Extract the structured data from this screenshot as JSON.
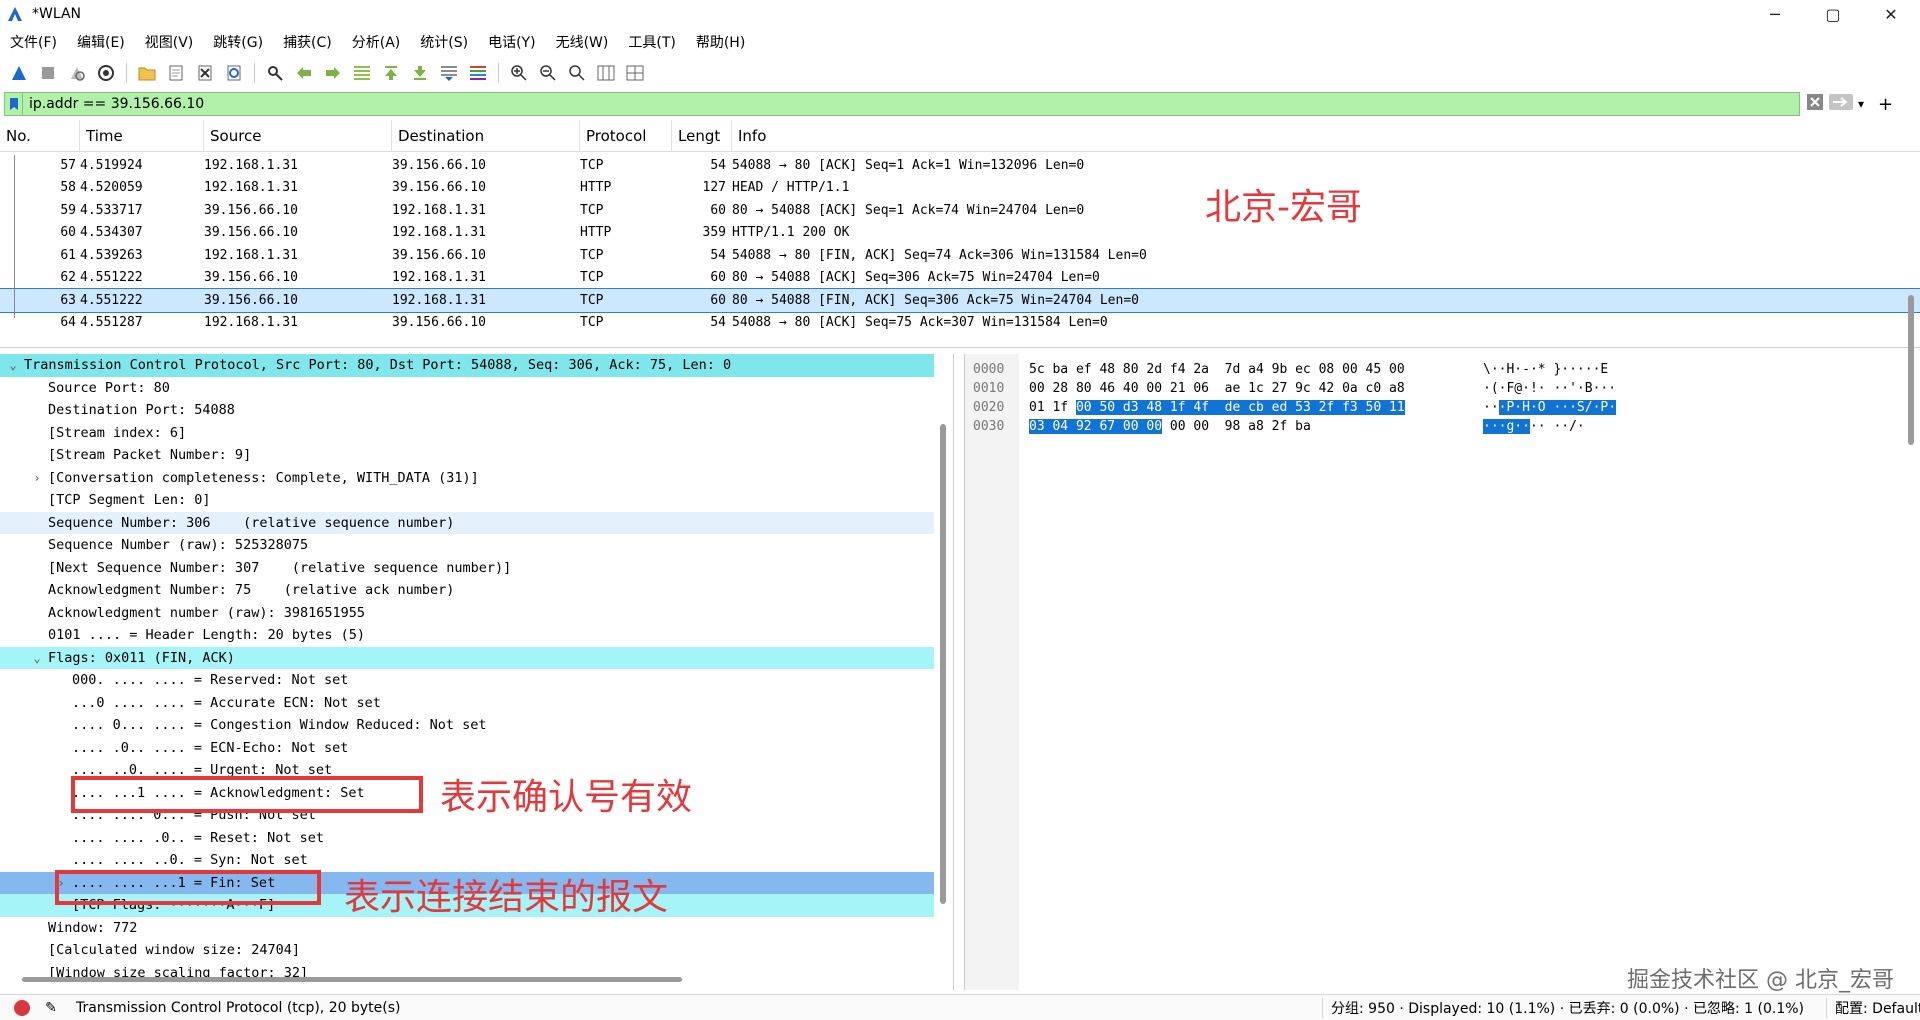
{
  "window": {
    "title": "*WLAN",
    "controls": [
      "─",
      "▢",
      "✕"
    ]
  },
  "menu": [
    "文件(F)",
    "编辑(E)",
    "视图(V)",
    "跳转(G)",
    "捕获(C)",
    "分析(A)",
    "统计(S)",
    "电话(Y)",
    "无线(W)",
    "工具(T)",
    "帮助(H)"
  ],
  "filter": {
    "value": "ip.addr == 39.156.66.10"
  },
  "packet_list": {
    "headers": [
      "No.",
      "Time",
      "Source",
      "Destination",
      "Protocol",
      "Lengt",
      "Info"
    ],
    "rows": [
      [
        "57",
        "4.519924",
        "192.168.1.31",
        "39.156.66.10",
        "TCP",
        "54",
        "54088 → 80 [ACK] Seq=1 Ack=1 Win=132096 Len=0"
      ],
      [
        "58",
        "4.520059",
        "192.168.1.31",
        "39.156.66.10",
        "HTTP",
        "127",
        "HEAD / HTTP/1.1"
      ],
      [
        "59",
        "4.533717",
        "39.156.66.10",
        "192.168.1.31",
        "TCP",
        "60",
        "80 → 54088 [ACK] Seq=1 Ack=74 Win=24704 Len=0"
      ],
      [
        "60",
        "4.534307",
        "39.156.66.10",
        "192.168.1.31",
        "HTTP",
        "359",
        "HTTP/1.1 200 OK"
      ],
      [
        "61",
        "4.539263",
        "192.168.1.31",
        "39.156.66.10",
        "TCP",
        "54",
        "54088 → 80 [FIN, ACK] Seq=74 Ack=306 Win=131584 Len=0"
      ],
      [
        "62",
        "4.551222",
        "39.156.66.10",
        "192.168.1.31",
        "TCP",
        "60",
        "80 → 54088 [ACK] Seq=306 Ack=75 Win=24704 Len=0"
      ],
      [
        "63",
        "4.551222",
        "39.156.66.10",
        "192.168.1.31",
        "TCP",
        "60",
        "80 → 54088 [FIN, ACK] Seq=306 Ack=75 Win=24704 Len=0"
      ],
      [
        "64",
        "4.551287",
        "192.168.1.31",
        "39.156.66.10",
        "TCP",
        "54",
        "54088 → 80 [ACK] Seq=75 Ack=307 Win=131584 Len=0"
      ]
    ],
    "selected_index": 6
  },
  "details": [
    {
      "indent": 0,
      "twist": "⌄",
      "text": "Transmission Control Protocol, Src Port: 80, Dst Port: 54088, Seq: 306, Ack: 75, Len: 0",
      "hl": "hl-top"
    },
    {
      "indent": 1,
      "twist": "",
      "text": "Source Port: 80",
      "hl": ""
    },
    {
      "indent": 1,
      "twist": "",
      "text": "Destination Port: 54088",
      "hl": ""
    },
    {
      "indent": 1,
      "twist": "",
      "text": "[Stream index: 6]",
      "hl": ""
    },
    {
      "indent": 1,
      "twist": "",
      "text": "[Stream Packet Number: 9]",
      "hl": ""
    },
    {
      "indent": 1,
      "twist": "›",
      "text": "[Conversation completeness: Complete, WITH_DATA (31)]",
      "hl": ""
    },
    {
      "indent": 1,
      "twist": "",
      "text": "[TCP Segment Len: 0]",
      "hl": ""
    },
    {
      "indent": 1,
      "twist": "",
      "text": "Sequence Number: 306    (relative sequence number)",
      "hl": "hl-light"
    },
    {
      "indent": 1,
      "twist": "",
      "text": "Sequence Number (raw): 525328075",
      "hl": ""
    },
    {
      "indent": 1,
      "twist": "",
      "text": "[Next Sequence Number: 307    (relative sequence number)]",
      "hl": ""
    },
    {
      "indent": 1,
      "twist": "",
      "text": "Acknowledgment Number: 75    (relative ack number)",
      "hl": ""
    },
    {
      "indent": 1,
      "twist": "",
      "text": "Acknowledgment number (raw): 3981651955",
      "hl": ""
    },
    {
      "indent": 1,
      "twist": "",
      "text": "0101 .... = Header Length: 20 bytes (5)",
      "hl": ""
    },
    {
      "indent": 1,
      "twist": "⌄",
      "text": "Flags: 0x011 (FIN, ACK)",
      "hl": "hl-cyan"
    },
    {
      "indent": 2,
      "twist": "",
      "text": "000. .... .... = Reserved: Not set",
      "hl": ""
    },
    {
      "indent": 2,
      "twist": "",
      "text": "...0 .... .... = Accurate ECN: Not set",
      "hl": ""
    },
    {
      "indent": 2,
      "twist": "",
      "text": ".... 0... .... = Congestion Window Reduced: Not set",
      "hl": ""
    },
    {
      "indent": 2,
      "twist": "",
      "text": ".... .0.. .... = ECN-Echo: Not set",
      "hl": ""
    },
    {
      "indent": 2,
      "twist": "",
      "text": ".... ..0. .... = Urgent: Not set",
      "hl": ""
    },
    {
      "indent": 2,
      "twist": "",
      "text": ".... ...1 .... = Acknowledgment: Set",
      "hl": ""
    },
    {
      "indent": 2,
      "twist": "",
      "text": ".... .... 0... = Push: Not set",
      "hl": ""
    },
    {
      "indent": 2,
      "twist": "",
      "text": ".... .... .0.. = Reset: Not set",
      "hl": ""
    },
    {
      "indent": 2,
      "twist": "",
      "text": ".... .... ..0. = Syn: Not set",
      "hl": ""
    },
    {
      "indent": 2,
      "twist": "›",
      "text": ".... .... ...1 = Fin: Set",
      "hl": "hl-blue"
    },
    {
      "indent": 2,
      "twist": "",
      "text": "[TCP Flags: ·······A···F]",
      "hl": "hl-cyan"
    },
    {
      "indent": 1,
      "twist": "",
      "text": "Window: 772",
      "hl": ""
    },
    {
      "indent": 1,
      "twist": "",
      "text": "[Calculated window size: 24704]",
      "hl": ""
    },
    {
      "indent": 1,
      "twist": "",
      "text": "[Window size scaling factor: 32]",
      "hl": ""
    }
  ],
  "hex": [
    {
      "off": "0000",
      "bytes": [
        [
          "5c ba ef 48 80 2d f4 2a  7d a4 9b ec 08 00 45 00",
          false
        ]
      ],
      "ascii": [
        [
          "\\··H·-·* }·····E",
          false
        ]
      ]
    },
    {
      "off": "0010",
      "bytes": [
        [
          "00 28 80 46 40 00 21 06  ae 1c 27 9c 42 0a c0 a8",
          false
        ]
      ],
      "ascii": [
        [
          "·(·F@·!· ··'·B···",
          false
        ]
      ]
    },
    {
      "off": "0020",
      "bytes": [
        [
          "01 1f ",
          false
        ],
        [
          "00 50 d3 48 1f 4f  de cb ed 53 2f f3 50 11",
          true
        ]
      ],
      "ascii": [
        [
          "··",
          false
        ],
        [
          "·P·H·O ···S/·P·",
          true
        ]
      ]
    },
    {
      "off": "0030",
      "bytes": [
        [
          "03 04 92 67 00 00",
          true
        ],
        [
          " 00 00  98 a8 2f ba",
          false
        ]
      ],
      "ascii": [
        [
          "···g··",
          true
        ],
        [
          "·· ··/·",
          false
        ]
      ]
    }
  ],
  "annotations": {
    "title": "北京-宏哥",
    "ack_note": "表示确认号有效",
    "fin_note": "表示连接结束的报文"
  },
  "watermark": "掘金技术社区 @ 北京_宏哥",
  "status": {
    "left": "Transmission Control Protocol (tcp), 20 byte(s)",
    "packets": "分组: 950 · Displayed: 10 (1.1%) · 已丢弃: 0 (0.0%) · 已忽略: 1 (0.1%)",
    "profile": "配置: Default"
  },
  "colors": {
    "filter_bg": "#b0f0a8",
    "annotation": "#e5383b",
    "selection": "#1173d4"
  }
}
